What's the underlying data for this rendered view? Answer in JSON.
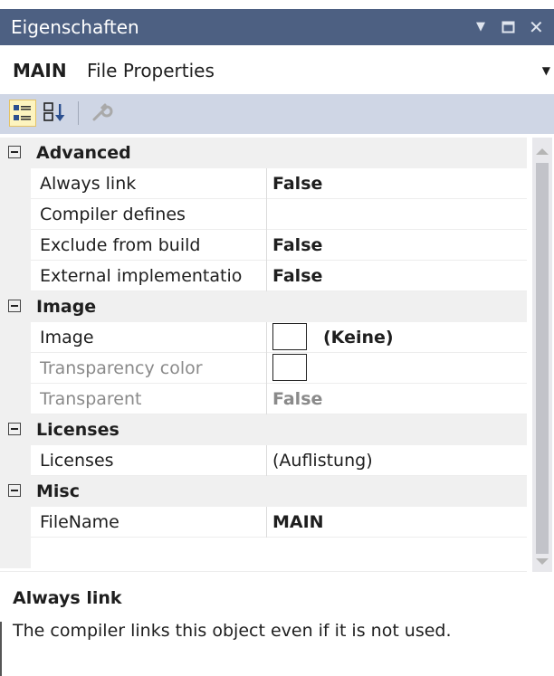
{
  "window": {
    "title": "Eigenschaften",
    "accent_color": "#4d6082"
  },
  "object_selector": {
    "name": "MAIN",
    "type": "File Properties"
  },
  "toolbar": {
    "buttons": [
      {
        "icon": "categorized-icon",
        "active": true
      },
      {
        "icon": "alphabetical-sort-icon",
        "active": false
      },
      {
        "icon": "property-pages-wrench-icon",
        "active": false
      }
    ]
  },
  "grid": {
    "categories": [
      {
        "label": "Advanced",
        "properties": [
          {
            "name": "Always link",
            "value": "False"
          },
          {
            "name": "Compiler defines",
            "value": ""
          },
          {
            "name": "Exclude from build",
            "value": "False"
          },
          {
            "name": "External implementatio",
            "value": "False"
          }
        ]
      },
      {
        "label": "Image",
        "properties": [
          {
            "name": "Image",
            "value": "(Keine)"
          },
          {
            "name": "Transparency color",
            "value": ""
          },
          {
            "name": "Transparent",
            "value": "False"
          }
        ]
      },
      {
        "label": "Licenses",
        "properties": [
          {
            "name": "Licenses",
            "value": "(Auflistung)"
          }
        ]
      },
      {
        "label": "Misc",
        "properties": [
          {
            "name": "FileName",
            "value": "MAIN"
          }
        ]
      }
    ]
  },
  "description": {
    "title": "Always link",
    "text": "The compiler links this object even if it is not used."
  }
}
